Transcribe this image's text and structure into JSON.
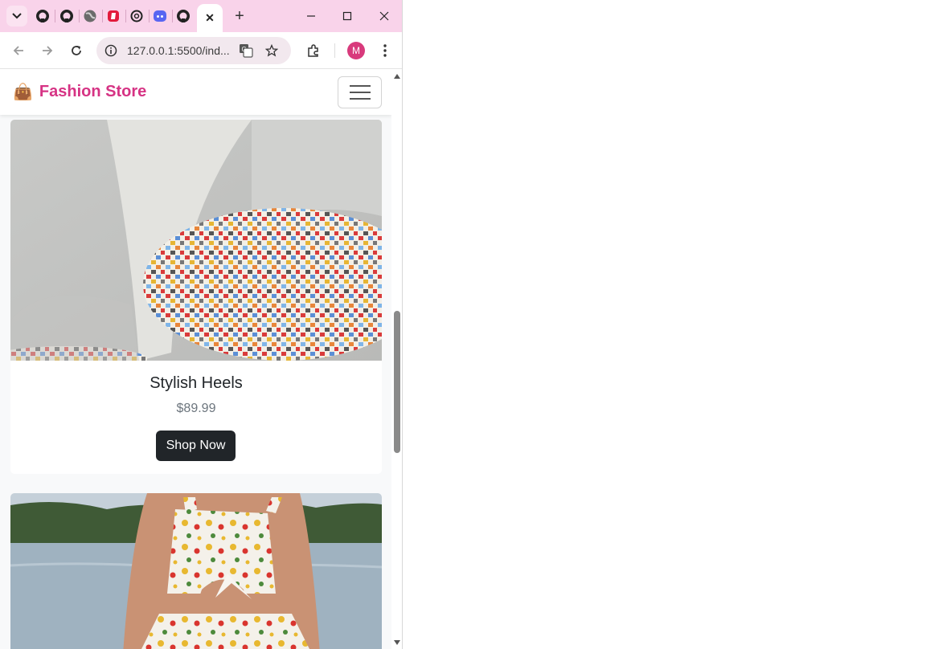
{
  "browser": {
    "tabs": [
      {
        "icon": "github-icon"
      },
      {
        "icon": "github-icon"
      },
      {
        "icon": "globe-icon"
      },
      {
        "icon": "red-app-icon"
      },
      {
        "icon": "openai-icon"
      },
      {
        "icon": "discord-icon"
      },
      {
        "icon": "github-icon"
      }
    ],
    "active_tab_close": "✕",
    "new_tab": "+",
    "url": "127.0.0.1:5500/ind...",
    "profile_initial": "M",
    "colors": {
      "tabstrip": "#f9d3ea",
      "profile": "#d83a7c"
    }
  },
  "page": {
    "brand": {
      "emoji": "👜",
      "name": "Fashion Store"
    },
    "products": [
      {
        "title": "Stylish Heels",
        "price": "$89.99",
        "button": "Shop Now"
      }
    ],
    "colors": {
      "brand": "#d63384",
      "button": "#212529"
    }
  }
}
